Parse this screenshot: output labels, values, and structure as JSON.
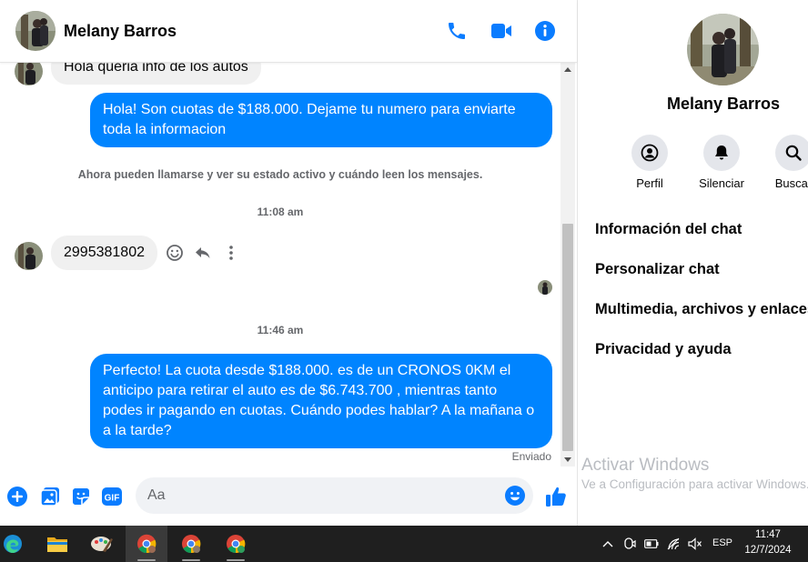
{
  "contact": {
    "name": "Melany Barros"
  },
  "messages": {
    "first_incoming": "Hola queria info de los autos",
    "reply_1": "Hola! Son cuotas de $188.000. Dejame tu numero para enviarte toda la informacion",
    "system_note": "Ahora pueden llamarse y ver su estado activo y cuándo leen los mensajes.",
    "time_1": "11:08 am",
    "phone_number": "2995381802",
    "time_2": "11:46 am",
    "reply_2": "Perfecto! La cuota desde $188.000. es de un CRONOS 0KM el anticipo para retirar el auto es de $6.743.700 , mientras tanto podes ir pagando en cuotas. Cuándo podes hablar? A la mañana o a la tarde?",
    "status": "Enviado"
  },
  "composer": {
    "placeholder": "Aa"
  },
  "panel": {
    "name": "Melany Barros",
    "actions": [
      {
        "label": "Perfil",
        "icon": "profile-icon"
      },
      {
        "label": "Silenciar",
        "icon": "bell-icon"
      },
      {
        "label": "Buscar",
        "icon": "search-icon"
      }
    ],
    "items": [
      "Información del chat",
      "Personalizar chat",
      "Multimedia, archivos y enlaces",
      "Privacidad y ayuda"
    ]
  },
  "watermark": {
    "title": "Activar Windows",
    "subtitle": "Ve a Configuración para activar Windows."
  },
  "taskbar": {
    "language": "ESP",
    "time": "11:47",
    "date": "12/7/2024"
  },
  "colors": {
    "accent": "#0084ff",
    "incoming_bubble": "#f0f0f0",
    "taskbar": "#1f1f1f"
  }
}
